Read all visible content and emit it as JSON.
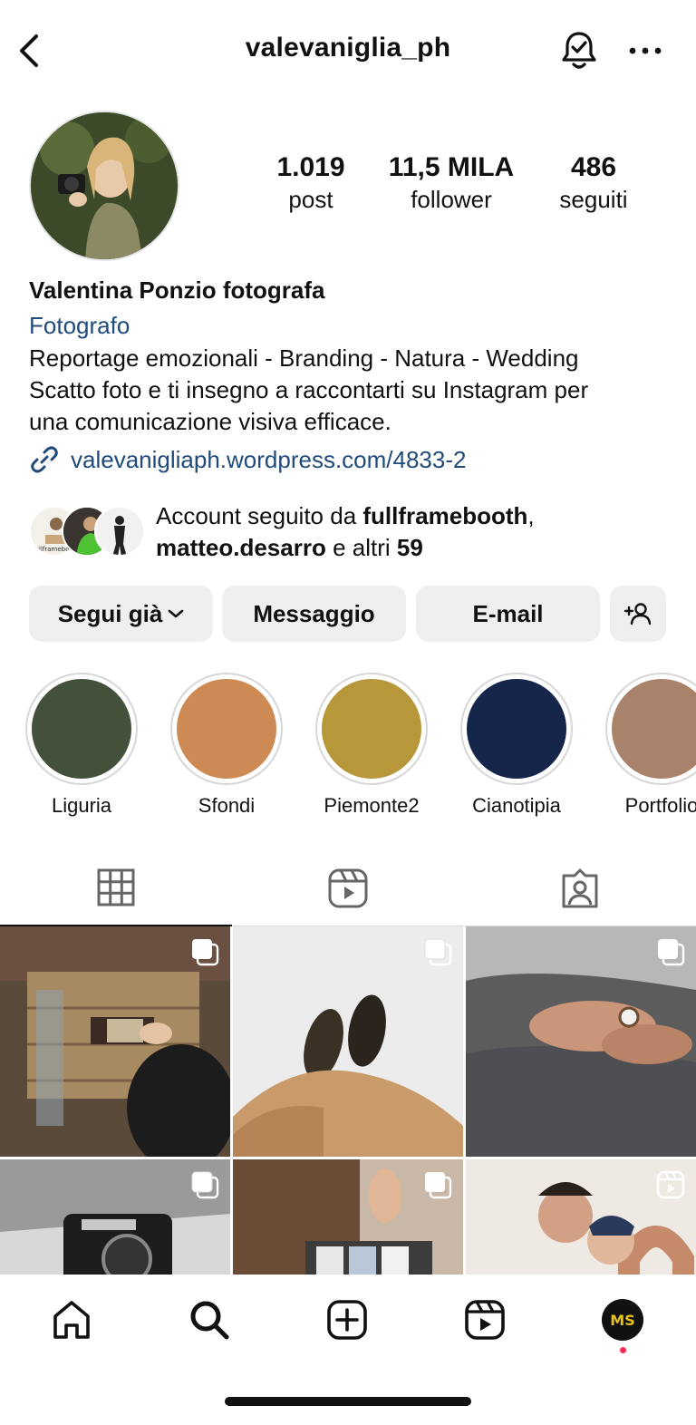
{
  "header": {
    "username": "valevaniglia_ph"
  },
  "profile": {
    "stats": [
      {
        "value": "1.019",
        "label": "post"
      },
      {
        "value": "11,5 MILA",
        "label": "follower"
      },
      {
        "value": "486",
        "label": "seguiti"
      }
    ],
    "name": "Valentina Ponzio fotografa",
    "category": "Fotografo",
    "bio_lines": [
      "Reportage emozionali - Branding - Natura - Wedding",
      "Scatto foto e ti insegno a raccontarti su Instagram per",
      "una comunicazione visiva efficace."
    ],
    "link": "valevanigliaph.wordpress.com/4833-2",
    "followed_by": {
      "prefix": "Account seguito da ",
      "user1": "fullframebooth",
      "comma": ",",
      "user2": "matteo.desarro",
      "middle": " e altri ",
      "count": "59"
    }
  },
  "buttons": {
    "following": "Segui già",
    "message": "Messaggio",
    "email": "E-mail"
  },
  "highlights": [
    {
      "label": "Liguria",
      "color": "#43503a"
    },
    {
      "label": "Sfondi",
      "color": "#cd8a54"
    },
    {
      "label": "Piemonte2",
      "color": "#b8963a"
    },
    {
      "label": "Cianotipia",
      "color": "#15264a"
    },
    {
      "label": "Portfolio",
      "color": "#a8826a"
    }
  ],
  "tabs": [
    {
      "icon": "grid-icon",
      "active": true
    },
    {
      "icon": "reels-icon",
      "active": false
    },
    {
      "icon": "tagged-icon",
      "active": false
    }
  ],
  "grid_posts": [
    {
      "subject": "mailbox with hand",
      "badge": "carousel-icon"
    },
    {
      "subject": "boots on snow",
      "badge": "carousel-icon"
    },
    {
      "subject": "elderly hands with watch",
      "badge": "carousel-icon"
    },
    {
      "subject": "vintage camera in snow",
      "badge": "carousel-icon"
    },
    {
      "subject": "photo prints in hand",
      "badge": "carousel-icon"
    },
    {
      "subject": "couple kissing",
      "badge": "reel-icon"
    }
  ],
  "bottom_nav": [
    {
      "icon": "home-icon"
    },
    {
      "icon": "search-icon"
    },
    {
      "icon": "create-icon"
    },
    {
      "icon": "reels-icon"
    },
    {
      "icon": "profile-avatar"
    }
  ],
  "profile_avatar_text": "MS",
  "colors": {
    "link": "#1f4a7a",
    "button_bg": "#efefef",
    "notification_dot": "#ff2d55"
  }
}
